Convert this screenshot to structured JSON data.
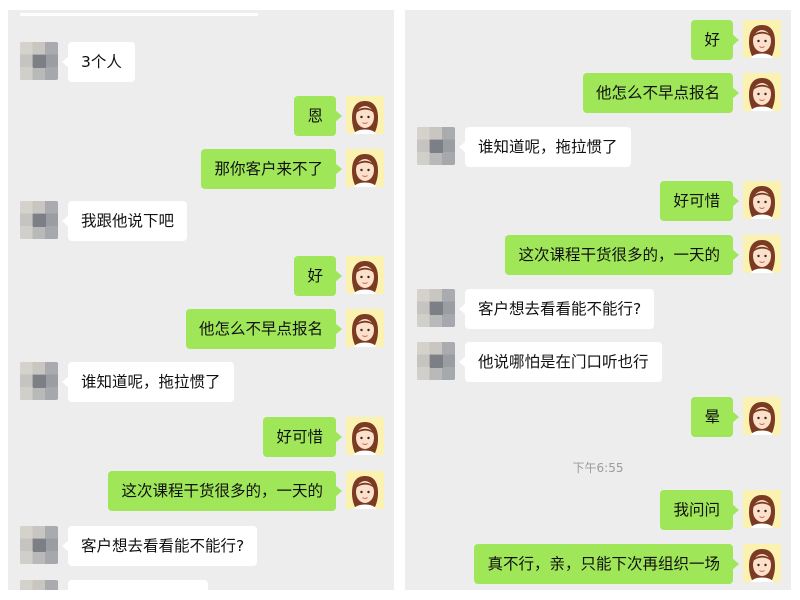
{
  "left_panel": {
    "messages": [
      {
        "side": "left",
        "text": "3个人"
      },
      {
        "side": "right",
        "text": "恩"
      },
      {
        "side": "right",
        "text": "那你客户来不了"
      },
      {
        "side": "left",
        "text": "我跟他说下吧"
      },
      {
        "side": "right",
        "text": "好"
      },
      {
        "side": "right",
        "text": "他怎么不早点报名"
      },
      {
        "side": "left",
        "text": "谁知道呢，拖拉惯了"
      },
      {
        "side": "right",
        "text": "好可惜"
      },
      {
        "side": "right",
        "text": "这次课程干货很多的，一天的"
      },
      {
        "side": "left",
        "text": "客户想去看看能不能行?"
      }
    ]
  },
  "right_panel": {
    "messages": [
      {
        "side": "right",
        "text": "好"
      },
      {
        "side": "right",
        "text": "他怎么不早点报名"
      },
      {
        "side": "left",
        "text": "谁知道呢，拖拉惯了"
      },
      {
        "side": "right",
        "text": "好可惜"
      },
      {
        "side": "right",
        "text": "这次课程干货很多的，一天的"
      },
      {
        "side": "left",
        "text": "客户想去看看能不能行?"
      },
      {
        "side": "left",
        "text": "他说哪怕是在门口听也行"
      },
      {
        "side": "right",
        "text": "晕"
      },
      {
        "side": "right",
        "text": "我问问"
      },
      {
        "side": "right",
        "text": "真不行，亲，只能下次再组织一场"
      }
    ],
    "timestamp": "下午6:55"
  },
  "icons": {
    "contact_avatar": "pixelated-avatar-icon",
    "self_avatar": "cartoon-girl-avatar-icon"
  },
  "colors": {
    "chat_background": "#ededed",
    "sent_bubble": "#9fe658",
    "received_bubble": "#ffffff",
    "self_avatar_background": "#fbf1b0"
  }
}
